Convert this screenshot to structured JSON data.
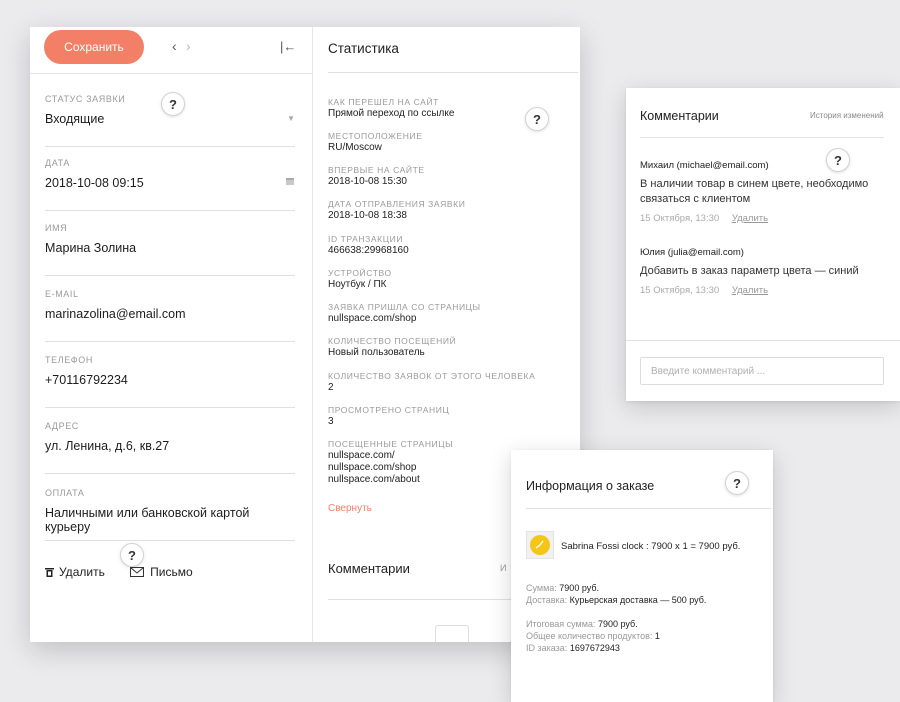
{
  "form": {
    "save_label": "Сохранить",
    "fields": [
      {
        "label": "Статус заявки",
        "value": "Входящие"
      },
      {
        "label": "Дата",
        "value": "2018-10-08 09:15"
      },
      {
        "label": "Имя",
        "value": "Марина Золина"
      },
      {
        "label": "E-mail",
        "value": "marinazolina@email.com"
      },
      {
        "label": "Телефон",
        "value": "+70116792234"
      },
      {
        "label": "Адрес",
        "value": "ул. Ленина, д.6, кв.27"
      },
      {
        "label": "Оплата",
        "value": "Наличными или банковской картой курьеру"
      }
    ],
    "delete_label": "Удалить",
    "letter_label": "Письмо"
  },
  "stats": {
    "title": "Статистика",
    "items": [
      {
        "label": "Как перешел на сайт",
        "value": "Прямой переход по ссылке"
      },
      {
        "label": "Местоположение",
        "value": "RU/Moscow"
      },
      {
        "label": "Впервые на сайте",
        "value": "2018-10-08 15:30"
      },
      {
        "label": "Дата отправления заявки",
        "value": "2018-10-08 18:38"
      },
      {
        "label": "ID транзакции",
        "value": "466638:29968160"
      },
      {
        "label": "Устройство",
        "value": "Ноутбук / ПК"
      },
      {
        "label": "Заявка пришла со страницы",
        "value": "nullspace.com/shop"
      },
      {
        "label": "Количество посещений",
        "value": "Новый пользователь"
      },
      {
        "label": "Количество заявок от этого человека",
        "value": "2"
      },
      {
        "label": "Просмотрено страниц",
        "value": "3"
      },
      {
        "label": "Посещенные страницы",
        "value": [
          "nullspace.com/",
          "nullspace.com/shop",
          "nullspace.com/about"
        ]
      }
    ],
    "collapse_label": "Свернуть",
    "comments_title": "Комментарии",
    "comments_history_partial": "И"
  },
  "comments": {
    "title": "Комментарии",
    "history_label": "История изменений",
    "items": [
      {
        "author": "Михаил (michael@email.com)",
        "text": "В наличии товар в синем цвете, необходимо связаться с клиентом",
        "time": "15 Октября, 13:30",
        "delete": "Удалить"
      },
      {
        "author": "Юлия (julia@email.com)",
        "text": "Добавить в заказ параметр цвета — синий",
        "time": "15 Октября, 13:30",
        "delete": "Удалить"
      }
    ],
    "input_placeholder": "Введите комментарий ..."
  },
  "order": {
    "title": "Информация о заказе",
    "item": "Sabrina Fossi clock : 7900 x 1 = 7900 руб.",
    "sum_label": "Сумма:",
    "sum_value": "7900 руб.",
    "delivery_label": "Доставка:",
    "delivery_value": "Курьерская доставка — 500 руб.",
    "total_label": "Итоговая сумма:",
    "total_value": "7900 руб.",
    "count_label": "Общее количество продуктов:",
    "count_value": "1",
    "id_label": "ID заказа:",
    "id_value": "1697672943"
  },
  "help_mark": "?",
  "colors": {
    "accent": "#f47f67",
    "background": "#ebebee"
  }
}
